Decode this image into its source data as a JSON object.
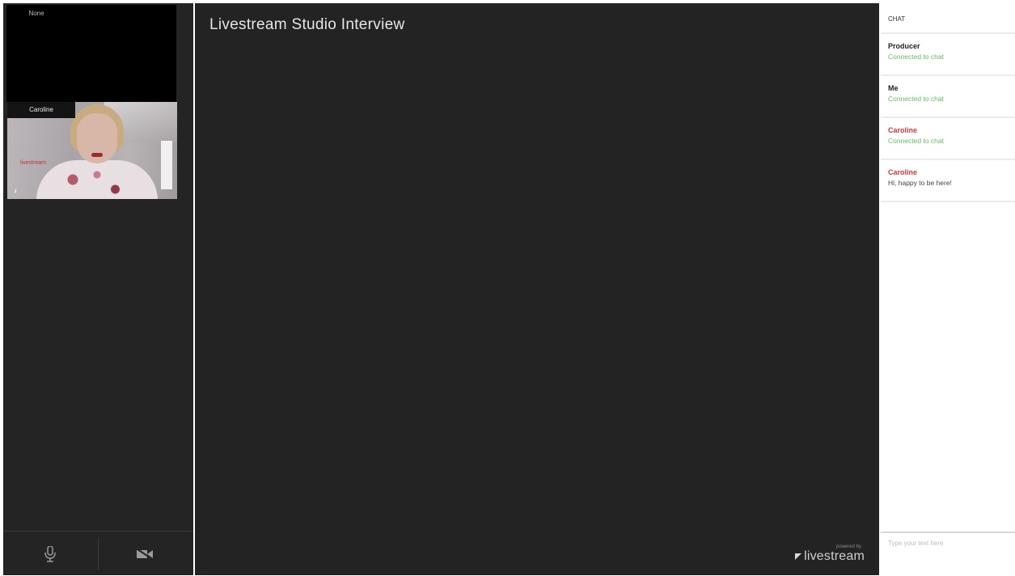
{
  "participants": [
    {
      "label": "None"
    },
    {
      "label": "Caroline",
      "logo_text": "livestream",
      "signal": "..ıl"
    }
  ],
  "stage": {
    "title": "Livestream Studio Interview",
    "brand_powered": "powered by",
    "brand_name": "livestream"
  },
  "controls": {
    "mic_icon": "microphone-icon",
    "camera_icon": "camera-off-icon"
  },
  "chat": {
    "header": "CHAT",
    "messages": [
      {
        "author": "Producer",
        "text": "Connected to chat",
        "author_color": "#222222",
        "text_color": "#5fbf5f"
      },
      {
        "author": "Me",
        "text": "Connected to chat",
        "author_color": "#222222",
        "text_color": "#5fbf5f"
      },
      {
        "author": "Caroline",
        "text": "Connected to chat",
        "author_color": "#d23a3a",
        "text_color": "#5fbf5f"
      },
      {
        "author": "Caroline",
        "text": "Hi, happy to be here!",
        "author_color": "#d23a3a",
        "text_color": "#444444"
      }
    ],
    "input_placeholder": "Type your text here"
  },
  "colors": {
    "stage_bg": "#232323",
    "accent_red": "#d23a3a",
    "status_green": "#5fbf5f"
  }
}
